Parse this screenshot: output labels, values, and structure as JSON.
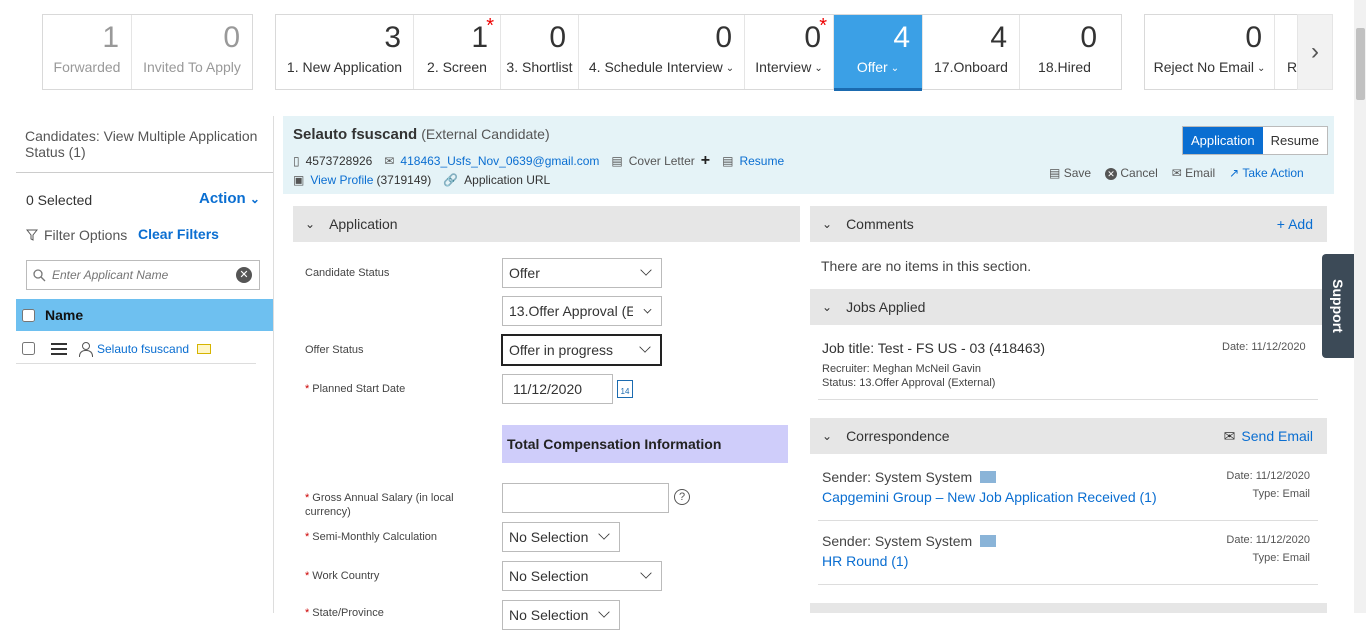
{
  "pipeline": {
    "group1": [
      {
        "count": "1",
        "label": "Forwarded"
      },
      {
        "count": "0",
        "label": "Invited To Apply"
      }
    ],
    "group2": [
      {
        "count": "3",
        "label": "1. New Application"
      },
      {
        "count": "1",
        "label": "2. Screen",
        "flag": "*"
      },
      {
        "count": "0",
        "label": "3. Shortlist"
      },
      {
        "count": "0",
        "label": "4. Schedule Interview"
      },
      {
        "count": "0",
        "label": "Interview",
        "flag": "*"
      },
      {
        "count": "4",
        "label": "Offer"
      },
      {
        "count": "4",
        "label": "17.Onboard"
      },
      {
        "count": "0",
        "label": "18.Hired"
      }
    ],
    "group3": [
      {
        "count": "0",
        "label": "Reject No Email"
      },
      {
        "count": "",
        "label": "Re"
      }
    ],
    "next_icon": "chevron-right-icon"
  },
  "left": {
    "title": "Candidates: View Multiple Application Status (1)",
    "selected": "0 Selected",
    "action": "Action",
    "filter_options": "Filter Options",
    "clear_filters": "Clear Filters",
    "search_placeholder": "Enter Applicant Name",
    "name_header": "Name",
    "candidate": "Selauto fsuscand"
  },
  "candidate_header": {
    "name": "Selauto fsuscand",
    "type": "(External Candidate)",
    "phone": "4573728926",
    "email": "418463_Usfs_Nov_0639@gmail.com",
    "cover_letter": "Cover Letter",
    "resume": "Resume",
    "view_profile": "View Profile",
    "profile_id": "(3719149)",
    "application_url": "Application URL",
    "toggle_application": "Application",
    "toggle_resume": "Resume",
    "actions": {
      "save": "Save",
      "cancel": "Cancel",
      "email": "Email",
      "take_action": "Take Action"
    }
  },
  "application": {
    "title": "Application",
    "candidate_status_label": "Candidate Status",
    "candidate_status_value": "Offer",
    "sub_status_value": "13.Offer Approval (E",
    "offer_status_label": "Offer Status",
    "offer_status_value": "Offer in progress",
    "planned_start_label": "Planned Start Date",
    "planned_start_value": "11/12/2020",
    "cal_day": "14",
    "total_comp": "Total Compensation Information",
    "gross_salary_label": "Gross Annual Salary (in local currency)",
    "semi_monthly_label": "Semi-Monthly Calculation",
    "semi_monthly_value": "No Selection",
    "work_country_label": "Work Country",
    "work_country_value": "No Selection",
    "state_label": "State/Province",
    "state_value": "No Selection"
  },
  "comments": {
    "title": "Comments",
    "add": "+ Add",
    "empty": "There are no items in this section."
  },
  "jobs_applied": {
    "title": "Jobs Applied",
    "job_title": "Job title: Test - FS US - 03 (418463)",
    "date": "Date: 11/12/2020",
    "recruiter": "Recruiter: Meghan McNeil Gavin",
    "status": "Status: 13.Offer Approval (External)"
  },
  "correspondence": {
    "title": "Correspondence",
    "send_email": "Send Email",
    "items": [
      {
        "sender": "Sender: System System",
        "subject": "Capgemini Group – New Job Application Received (1)",
        "date": "Date: 11/12/2020",
        "type": "Type: Email"
      },
      {
        "sender": "Sender: System System",
        "subject": "HR Round (1)",
        "date": "Date: 11/12/2020",
        "type": "Type: Email"
      }
    ]
  },
  "support": "Support",
  "colors": {
    "accent": "#0a6ed1",
    "active_stage": "#3ba0e6",
    "header_bg": "#e5f3f7",
    "name_header_bg": "#6ec0f0",
    "tci_bg": "#cfcdfa"
  }
}
